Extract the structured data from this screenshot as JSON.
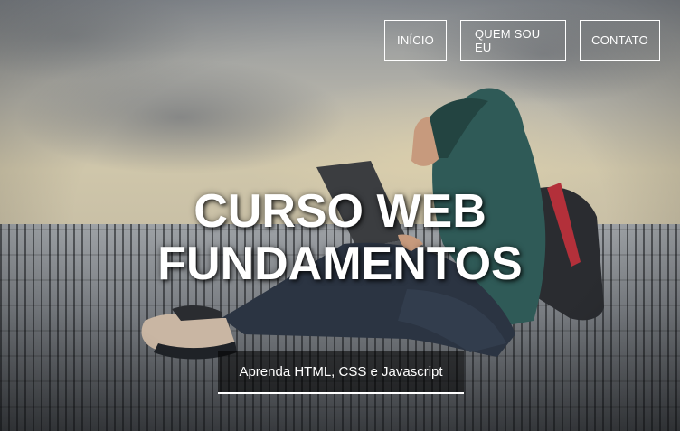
{
  "nav": {
    "items": [
      {
        "label": "INÍCIO"
      },
      {
        "label": "QUEM SOU EU"
      },
      {
        "label": "CONTATO"
      }
    ]
  },
  "hero": {
    "title_line1": "CURSO WEB",
    "title_line2": "FUNDAMENTOS",
    "subtitle": "Aprenda HTML, CSS e Javascript",
    "background_image": "person-with-laptop-on-wooden-deck-photo"
  },
  "colors": {
    "text": "#ffffff",
    "subtitle_bg": "rgba(0,0,0,0.55)",
    "hoodie": "#2f5a57",
    "jeans": "#2b3442"
  }
}
